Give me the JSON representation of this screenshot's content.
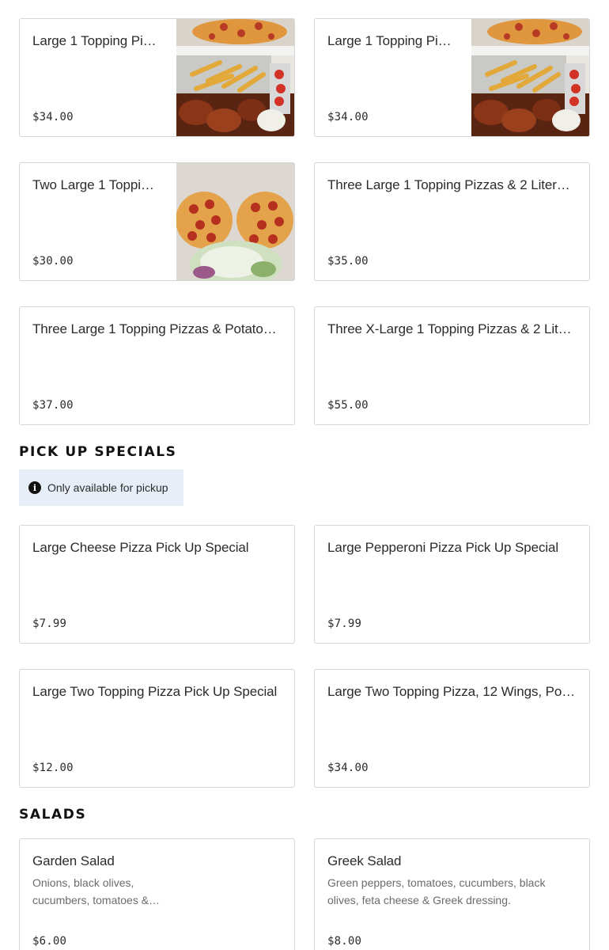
{
  "combos": [
    {
      "title": "Large 1 Topping Pizz…",
      "price": "$34.00",
      "image": "pizza-fries-wings-photo"
    },
    {
      "title": "Large 1 Topping Pizz…",
      "price": "$34.00",
      "image": "pizza-fries-wings-photo"
    },
    {
      "title": "Two Large 1 Topping…",
      "price": "$30.00",
      "image": "two-pizzas-salad-photo"
    },
    {
      "title": "Three Large 1 Topping Pizzas & 2 Liter…",
      "price": "$35.00"
    },
    {
      "title": "Three Large 1 Topping Pizzas & Potato…",
      "price": "$37.00"
    },
    {
      "title": "Three X-Large 1 Topping Pizzas & 2 Liter…",
      "price": "$55.00"
    }
  ],
  "pickup": {
    "heading": "PICK UP SPECIALS",
    "notice": "Only available for pickup",
    "items": [
      {
        "title": "Large Cheese Pizza Pick Up Special",
        "price": "$7.99"
      },
      {
        "title": "Large Pepperoni Pizza Pick Up Special",
        "price": "$7.99"
      },
      {
        "title": "Large Two Topping Pizza Pick Up Special",
        "price": "$12.00"
      },
      {
        "title": "Large Two Topping Pizza, 12 Wings, Potat…",
        "price": "$34.00"
      }
    ]
  },
  "salads": {
    "heading": "SALADS",
    "items": [
      {
        "title": "Garden Salad",
        "description": "Onions, black olives, cucumbers, tomatoes &…",
        "price": "$6.00"
      },
      {
        "title": "Greek Salad",
        "description": "Green peppers, tomatoes, cucumbers, black olives, feta cheese & Greek dressing.",
        "price": "$8.00"
      }
    ]
  }
}
